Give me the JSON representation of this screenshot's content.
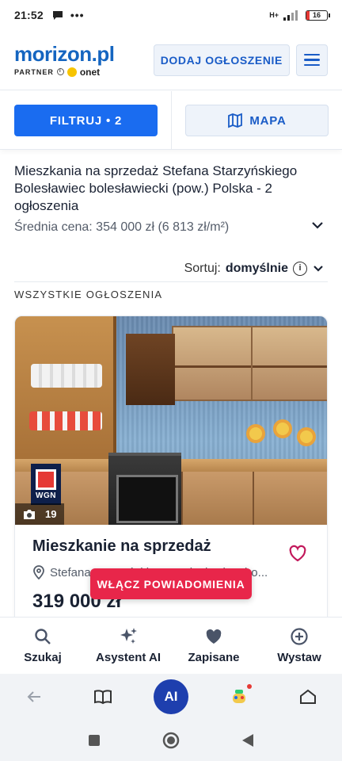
{
  "status_bar": {
    "time": "21:52",
    "network": "H+",
    "battery": "16"
  },
  "header": {
    "logo": "morizon.pl",
    "partner_label": "PARTNER",
    "partner_brand": "onet",
    "add_listing_label": "DODAJ OGŁOSZENIE"
  },
  "filters": {
    "filter_label": "FILTRUJ • 2",
    "map_label": "MAPA"
  },
  "listing_header": {
    "title": "Mieszkania na sprzedaż Stefana Starzyńskiego Bolesławiec bolesławiecki (pow.) Polska - 2 ogłoszenia",
    "average_price": "Średnia cena: 354 000 zł (6 813 zł/m²)",
    "sort_label": "Sortuj:",
    "sort_value": "domyślnie",
    "all_listings_label": "WSZYSTKIE OGŁOSZENIA"
  },
  "card": {
    "photo_count": "19",
    "agency_logo_text": "WGN",
    "title": "Mieszkanie na sprzedaż",
    "address": "Stefana Starzyńskiego, Bolesławiec, bo...",
    "price": "319 000 zł",
    "notify_button": "WŁĄCZ POWIADOMIENIA"
  },
  "app_nav": {
    "items": [
      {
        "label": "Szukaj",
        "icon": "search-icon"
      },
      {
        "label": "Asystent AI",
        "icon": "sparkle-icon"
      },
      {
        "label": "Zapisane",
        "icon": "heart-icon"
      },
      {
        "label": "Wystaw",
        "icon": "plus-circle-icon"
      }
    ]
  },
  "browser_bar": {
    "ai_label": "AI"
  },
  "colors": {
    "brand_blue": "#1565c0",
    "filter_blue": "#1a6cf0",
    "notify_red": "#e8264a",
    "heart_pink": "#c2185b"
  }
}
